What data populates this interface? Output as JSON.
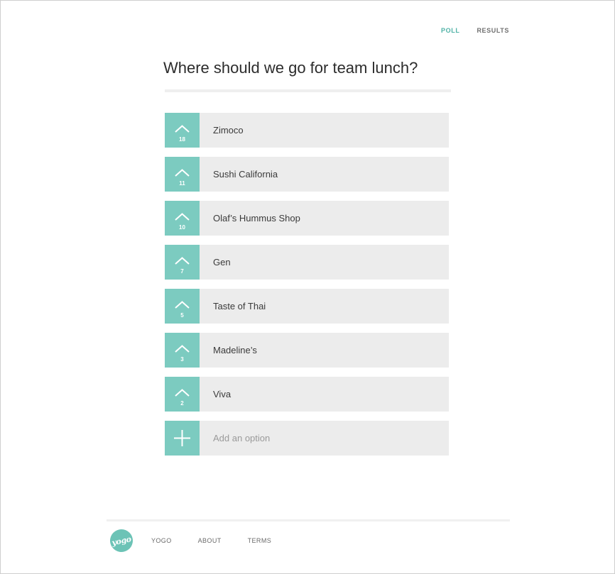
{
  "nav": {
    "poll": "POLL",
    "results": "RESULTS",
    "active": "poll",
    "accent_color": "#4fb2a6"
  },
  "poll": {
    "question": "Where should we go for team lunch?",
    "options": [
      {
        "label": "Zimoco",
        "votes": "18"
      },
      {
        "label": "Sushi California",
        "votes": "11"
      },
      {
        "label": "Olaf’s Hummus Shop",
        "votes": "10"
      },
      {
        "label": "Gen",
        "votes": "7"
      },
      {
        "label": "Taste of Thai",
        "votes": "5"
      },
      {
        "label": "Madeline’s",
        "votes": "3"
      },
      {
        "label": "Viva",
        "votes": "2"
      }
    ],
    "add_placeholder": "Add an option",
    "vote_color": "#7ccbc0"
  },
  "footer": {
    "logo_text": "yogo",
    "links": [
      "YOGO",
      "ABOUT",
      "TERMS"
    ]
  },
  "icons": {
    "upvote": "chevron-up-icon",
    "add": "plus-icon"
  }
}
